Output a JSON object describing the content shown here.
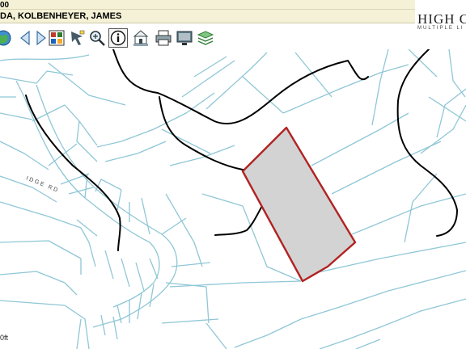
{
  "header": {
    "line1": "00",
    "line2": "DA, KOLBENHEYER, JAMES"
  },
  "logo": {
    "main": "HIGH C",
    "sub": "MULTIPLE LI"
  },
  "toolbar": {
    "icons": [
      "globe-icon",
      "back-arrow-icon",
      "forward-arrow-icon",
      "map-grid-icon",
      "select-pointer-icon",
      "zoom-tool-icon",
      "info-icon",
      "property-icon",
      "print-icon",
      "screen-icon",
      "layers-icon"
    ]
  },
  "map": {
    "road_label": "IDGE RD",
    "scale_label": "0ft",
    "colors": {
      "parcel_line": "#8fc7d6",
      "contour": "#000000",
      "selected_fill": "#d3d3d3",
      "selected_stroke": "#b22222"
    }
  }
}
